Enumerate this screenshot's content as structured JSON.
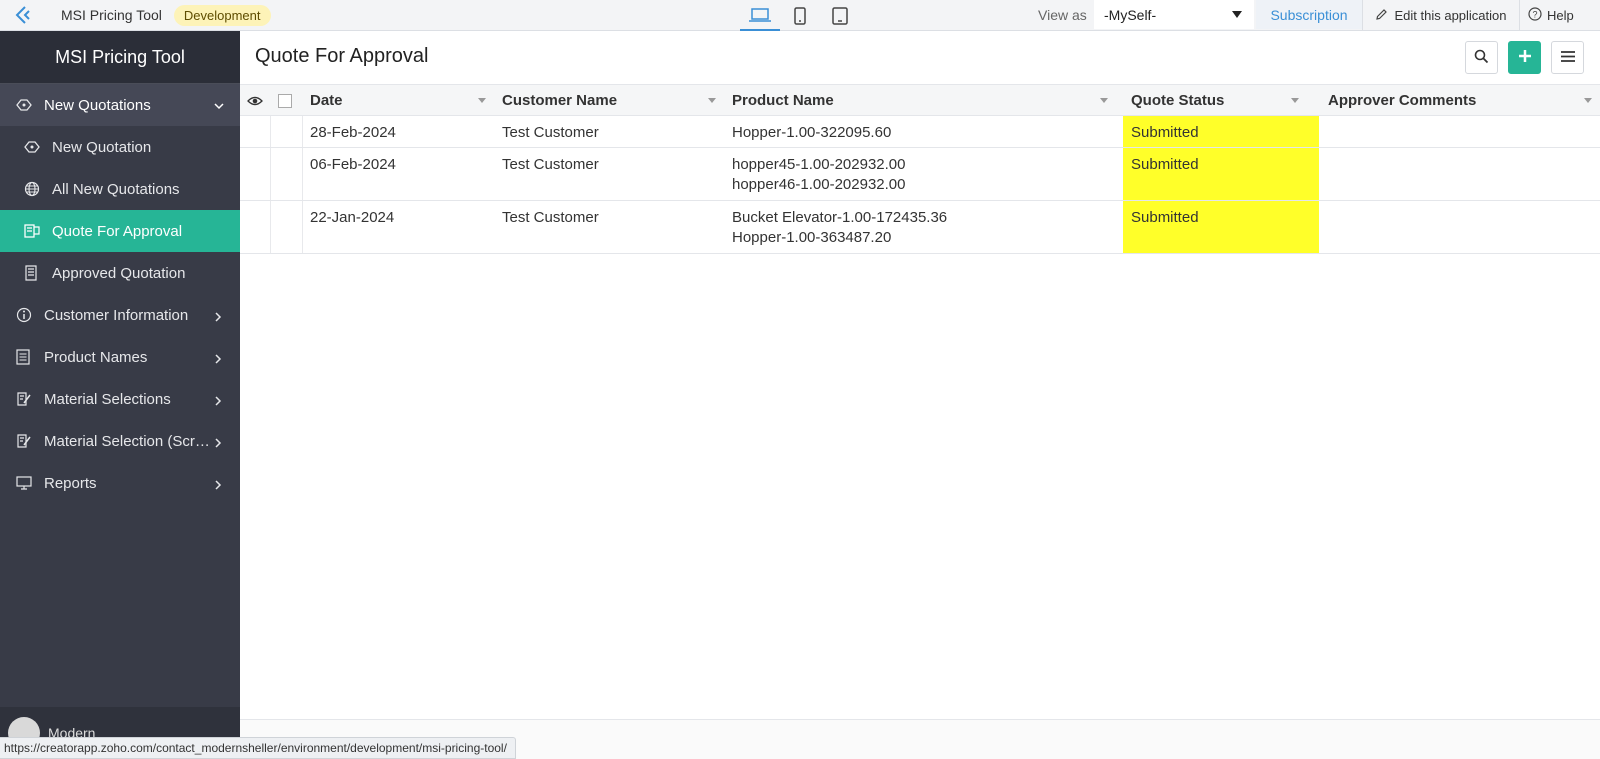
{
  "topbar": {
    "app_name": "MSI Pricing Tool",
    "env_badge": "Development",
    "view_as_label": "View as",
    "view_as_value": "-MySelf-",
    "subscription": "Subscription",
    "edit_app": "Edit this application",
    "help": "Help"
  },
  "sidebar": {
    "title": "MSI Pricing Tool",
    "group": "New Quotations",
    "sub_items": [
      {
        "label": "New Quotation"
      },
      {
        "label": "All New Quotations"
      },
      {
        "label": "Quote For Approval"
      },
      {
        "label": "Approved Quotation"
      }
    ],
    "items": [
      {
        "label": "Customer Information"
      },
      {
        "label": "Product Names"
      },
      {
        "label": "Material Selections"
      },
      {
        "label": "Material Selection (Scre..."
      },
      {
        "label": "Reports"
      }
    ],
    "user": "Modern"
  },
  "main": {
    "title": "Quote For Approval",
    "columns": [
      "Date",
      "Customer Name",
      "Product Name",
      "Quote Status",
      "Approver Comments"
    ],
    "rows": [
      {
        "date": "28-Feb-2024",
        "customer": "Test Customer",
        "products": [
          "Hopper-1.00-322095.60"
        ],
        "status": "Submitted",
        "comments": ""
      },
      {
        "date": "06-Feb-2024",
        "customer": "Test Customer",
        "products": [
          "hopper45-1.00-202932.00",
          "hopper46-1.00-202932.00"
        ],
        "status": "Submitted",
        "comments": ""
      },
      {
        "date": "22-Jan-2024",
        "customer": "Test Customer",
        "products": [
          "Bucket Elevator-1.00-172435.36",
          "Hopper-1.00-363487.20"
        ],
        "status": "Submitted",
        "comments": ""
      }
    ]
  },
  "statusbar": {
    "url": "https://creatorapp.zoho.com/contact_modernsheller/environment/development/msi-pricing-tool/"
  },
  "colors": {
    "accent": "#26b596",
    "status_highlight": "#ffff29",
    "sidebar_bg": "#383b47"
  }
}
